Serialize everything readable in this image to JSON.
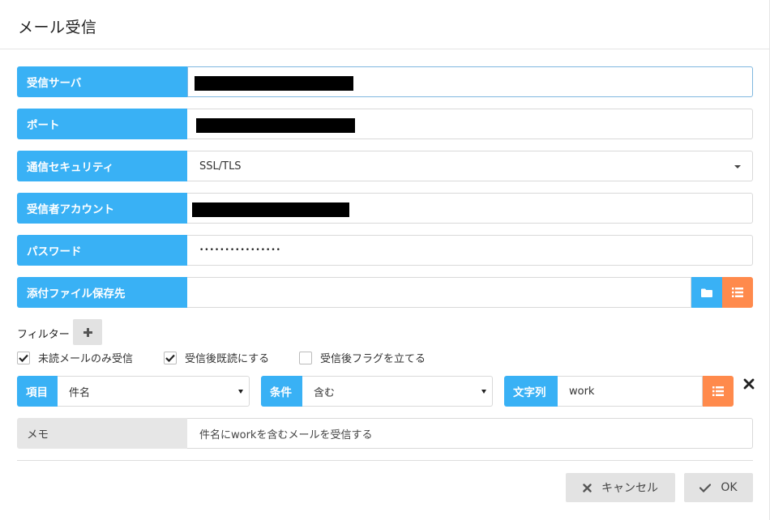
{
  "dialog": {
    "title": "メール受信"
  },
  "form": {
    "server": {
      "label": "受信サーバ",
      "value": ""
    },
    "port": {
      "label": "ポート",
      "value": ""
    },
    "security": {
      "label": "通信セキュリティ",
      "value": "SSL/TLS"
    },
    "account": {
      "label": "受信者アカウント",
      "value": ""
    },
    "password": {
      "label": "パスワード",
      "value": "••••••••••••••••"
    },
    "save_dir": {
      "label": "添付ファイル保存先",
      "value": ""
    }
  },
  "filter": {
    "label": "フィルター",
    "checkboxes": [
      {
        "label": "未読メールのみ受信",
        "checked": true
      },
      {
        "label": "受信後既読にする",
        "checked": true
      },
      {
        "label": "受信後フラグを立てる",
        "checked": false
      }
    ],
    "rule": {
      "item_label": "項目",
      "item_value": "件名",
      "cond_label": "条件",
      "cond_value": "含む",
      "str_label": "文字列",
      "str_value": "work"
    }
  },
  "memo": {
    "label": "メモ",
    "value": "件名にworkを含むメールを受信する"
  },
  "buttons": {
    "cancel": "キャンセル",
    "ok": "OK"
  },
  "colors": {
    "accent_blue": "#39b1f5",
    "accent_orange": "#ff8a4c",
    "memo_gray": "#e6e6e6"
  }
}
